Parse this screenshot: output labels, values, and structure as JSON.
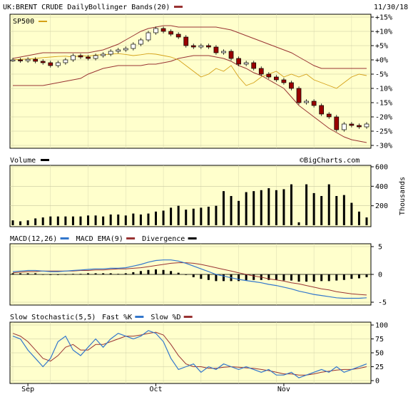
{
  "header": {
    "symbol_title": "UK:BRENT CRUDE Daily",
    "overlay_label": "Bollinger Bands(20)",
    "date": "11/30/18",
    "compare_label": "SP500"
  },
  "colors": {
    "panel_bg": "#ffffcc",
    "up_candle": "#ffffff",
    "down_candle": "#990000",
    "bollinger": "#993333",
    "sp500": "#d4a017",
    "macd": "#3377cc",
    "macd_ema": "#993333",
    "stoch_fast": "#3377cc",
    "stoch_slow": "#993333",
    "bars": "#000000"
  },
  "watermark": "©BigCharts.com",
  "chart_data": [
    {
      "type": "candlestick",
      "name": "price",
      "ylabel": "",
      "ylim": [
        -30,
        15
      ],
      "yticks": [
        "+15%",
        "+10%",
        "+5%",
        "+0%",
        "-5%",
        "-10%",
        "-15%",
        "-20%",
        "-25%",
        "-30%"
      ],
      "ytick_values": [
        15,
        10,
        5,
        0,
        -5,
        -10,
        -15,
        -20,
        -25,
        -30
      ],
      "series": [
        {
          "name": "UK:BRENT CRUDE",
          "values": [
            0,
            -0.3,
            0.2,
            -0.5,
            -1.0,
            -2.0,
            -1.0,
            0,
            1.5,
            1.0,
            0.5,
            1.5,
            2.0,
            3.0,
            3.5,
            4.0,
            5.5,
            7.0,
            9.5,
            11.0,
            10.0,
            9.0,
            8.0,
            5.0,
            4.5,
            5.0,
            4.5,
            2.5,
            3.0,
            0.5,
            -1.5,
            -1.0,
            -3.0,
            -5.0,
            -6.0,
            -7.0,
            -8.0,
            -10.0,
            -15.0,
            -14.5,
            -16.0,
            -19.0,
            -20.0,
            -24.5,
            -22.5,
            -23.0,
            -23.5,
            -22.5
          ]
        },
        {
          "name": "SP500",
          "values": [
            0,
            0.2,
            0.3,
            0.5,
            0.8,
            1.0,
            1.2,
            1.3,
            1.0,
            1.5,
            1.3,
            1.7,
            1.8,
            2.0,
            2.2,
            1.9,
            1.5,
            1.8,
            2.2,
            2.0,
            1.5,
            1.0,
            0,
            -2.0,
            -4.0,
            -6.0,
            -5.0,
            -3.0,
            -4.0,
            -2.0,
            -6.0,
            -9.0,
            -8.0,
            -6.0,
            -5.0,
            -4.0,
            -6.0,
            -5.0,
            -6.0,
            -5.0,
            -7.0,
            -8.0,
            -9.0,
            -10.0,
            -8.0,
            -6.0,
            -5.0,
            -5.5
          ]
        },
        {
          "name": "Bollinger Upper",
          "values": [
            0.5,
            1.0,
            1.5,
            2.0,
            2.5,
            2.5,
            2.5,
            2.5,
            2.5,
            2.5,
            2.5,
            3.0,
            3.5,
            4.5,
            5.5,
            7.0,
            8.5,
            10.0,
            11.0,
            11.5,
            12.0,
            12.0,
            11.5,
            11.5,
            11.5,
            11.5,
            11.5,
            11.5,
            11.0,
            10.5,
            9.5,
            8.5,
            7.5,
            6.5,
            5.5,
            4.5,
            3.5,
            2.5,
            1.0,
            -0.5,
            -2.0,
            -3.0,
            -3.0,
            -3.0,
            -3.0,
            -3.0,
            -3.0,
            -3.0
          ]
        },
        {
          "name": "Bollinger Lower",
          "values": [
            -9.0,
            -9.0,
            -9.0,
            -9.0,
            -9.0,
            -8.5,
            -8.0,
            -7.5,
            -7.0,
            -6.5,
            -5.0,
            -4.0,
            -3.0,
            -2.5,
            -2.0,
            -2.0,
            -2.0,
            -2.0,
            -1.5,
            -1.5,
            -1.0,
            -0.5,
            0.5,
            1.0,
            1.5,
            1.5,
            1.5,
            1.0,
            0.5,
            -0.5,
            -2.0,
            -3.0,
            -4.5,
            -5.5,
            -7.0,
            -8.5,
            -10.0,
            -13.0,
            -16.0,
            -18.0,
            -20.0,
            -22.0,
            -24.0,
            -25.5,
            -27.0,
            -28.0,
            -28.5,
            -29.0
          ]
        }
      ]
    },
    {
      "type": "bar",
      "name": "volume",
      "title": "Volume",
      "ylabel": "Thousands",
      "ylim": [
        0,
        600
      ],
      "yticks": [
        "600",
        "400",
        "200"
      ],
      "ytick_values": [
        600,
        400,
        200
      ],
      "values": [
        50,
        40,
        50,
        70,
        80,
        90,
        90,
        90,
        90,
        90,
        100,
        100,
        90,
        110,
        110,
        100,
        120,
        110,
        120,
        140,
        150,
        180,
        200,
        160,
        170,
        180,
        190,
        200,
        350,
        300,
        250,
        340,
        350,
        360,
        380,
        360,
        370,
        420,
        30,
        420,
        330,
        300,
        420,
        300,
        310,
        230,
        140,
        80
      ]
    },
    {
      "type": "line",
      "name": "macd",
      "title": "MACD(12,26)",
      "ylim": [
        -5,
        5
      ],
      "yticks": [
        "5",
        "0",
        "-5"
      ],
      "ytick_values": [
        5,
        0,
        -5
      ],
      "legend": [
        "MACD(12,26)",
        "MACD EMA(9)",
        "Divergence"
      ],
      "series": [
        {
          "name": "MACD(12,26)",
          "values": [
            0.5,
            0.6,
            0.7,
            0.7,
            0.6,
            0.5,
            0.5,
            0.6,
            0.7,
            0.8,
            0.9,
            1.0,
            1.0,
            1.1,
            1.1,
            1.2,
            1.5,
            1.8,
            2.2,
            2.5,
            2.6,
            2.6,
            2.4,
            2.0,
            1.5,
            1.0,
            0.5,
            0.0,
            -0.3,
            -0.6,
            -0.9,
            -1.1,
            -1.3,
            -1.5,
            -1.8,
            -2.0,
            -2.3,
            -2.6,
            -3.0,
            -3.3,
            -3.6,
            -3.8,
            -4.0,
            -4.2,
            -4.3,
            -4.3,
            -4.3,
            -4.2
          ]
        },
        {
          "name": "MACD EMA(9)",
          "values": [
            0.3,
            0.4,
            0.5,
            0.5,
            0.6,
            0.6,
            0.6,
            0.6,
            0.6,
            0.7,
            0.7,
            0.8,
            0.8,
            0.9,
            1.0,
            1.0,
            1.1,
            1.2,
            1.4,
            1.6,
            1.8,
            2.0,
            2.1,
            2.1,
            2.0,
            1.8,
            1.5,
            1.2,
            0.9,
            0.6,
            0.3,
            0.0,
            -0.3,
            -0.5,
            -0.8,
            -1.0,
            -1.2,
            -1.5,
            -1.7,
            -2.0,
            -2.3,
            -2.6,
            -2.8,
            -3.1,
            -3.3,
            -3.5,
            -3.6,
            -3.7
          ]
        },
        {
          "name": "Divergence",
          "values": [
            0.2,
            0.2,
            0.2,
            0.2,
            0.0,
            -0.1,
            -0.1,
            0.0,
            0.1,
            0.1,
            0.2,
            0.2,
            0.2,
            0.2,
            0.1,
            0.2,
            0.4,
            0.6,
            0.8,
            0.9,
            0.8,
            0.6,
            0.3,
            -0.1,
            -0.5,
            -0.8,
            -1.0,
            -1.2,
            -1.2,
            -1.2,
            -1.2,
            -1.1,
            -1.0,
            -1.0,
            -1.0,
            -1.0,
            -1.1,
            -1.1,
            -1.3,
            -1.3,
            -1.3,
            -1.2,
            -1.2,
            -1.1,
            -1.0,
            -0.8,
            -0.7,
            -0.5
          ]
        }
      ]
    },
    {
      "type": "line",
      "name": "stochastic",
      "title": "Slow Stochastic(5,5)",
      "ylim": [
        0,
        100
      ],
      "yticks": [
        "100",
        "75",
        "50",
        "25",
        "0"
      ],
      "ytick_values": [
        100,
        75,
        50,
        25,
        0
      ],
      "legend": [
        "Fast %K",
        "Slow %D"
      ],
      "series": [
        {
          "name": "Fast %K",
          "values": [
            80,
            75,
            55,
            40,
            25,
            40,
            70,
            80,
            55,
            45,
            60,
            75,
            60,
            75,
            85,
            80,
            75,
            80,
            90,
            85,
            70,
            40,
            20,
            25,
            30,
            15,
            25,
            20,
            30,
            25,
            20,
            25,
            20,
            15,
            20,
            10,
            10,
            15,
            5,
            10,
            15,
            20,
            15,
            25,
            15,
            20,
            25,
            30
          ]
        },
        {
          "name": "Slow %D",
          "values": [
            85,
            80,
            70,
            55,
            40,
            35,
            45,
            60,
            65,
            55,
            55,
            65,
            65,
            70,
            75,
            80,
            80,
            82,
            85,
            87,
            82,
            65,
            45,
            30,
            25,
            25,
            22,
            22,
            24,
            25,
            24,
            23,
            22,
            20,
            18,
            15,
            12,
            12,
            10,
            10,
            12,
            15,
            17,
            19,
            20,
            20,
            22,
            25
          ]
        }
      ]
    }
  ],
  "x_axis": {
    "labels": [
      "Sep",
      "Oct",
      "Nov"
    ],
    "label_index": [
      2,
      19,
      36
    ]
  }
}
